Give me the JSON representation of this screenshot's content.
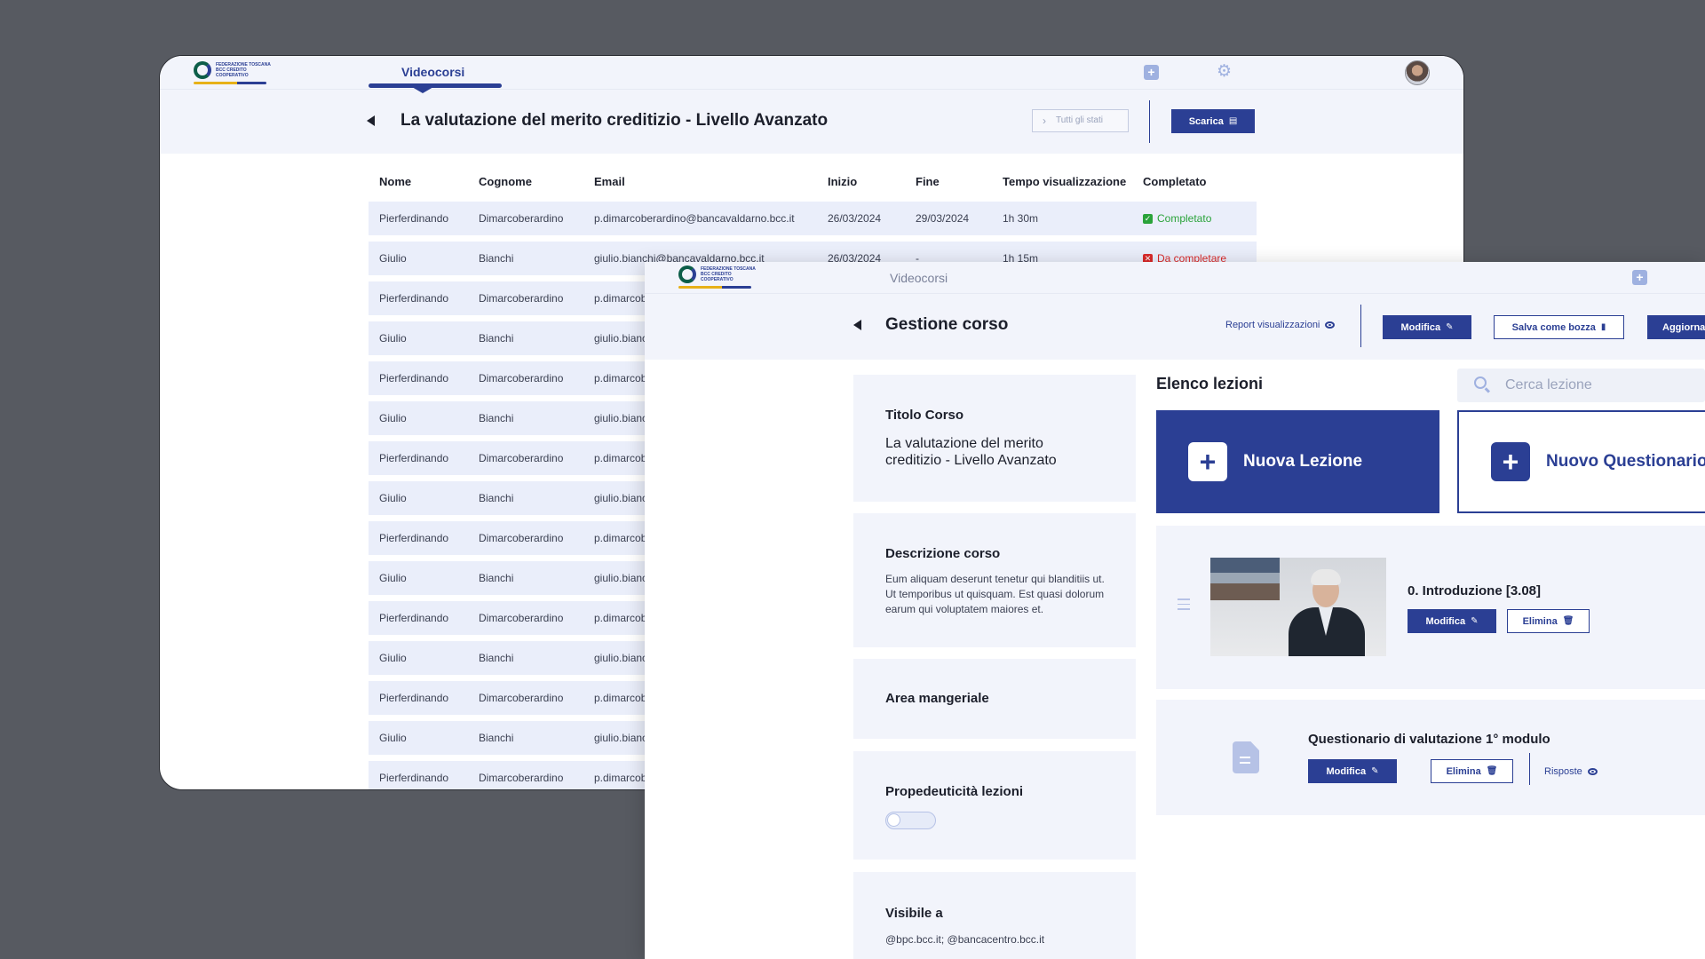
{
  "back_window": {
    "nav_tab": "Videocorsi",
    "logo_text": "FEDERAZIONE TOSCANA BCC CREDITO COOPERATIVO",
    "page_title": "La valutazione del merito creditizio - Livello Avanzato",
    "filter_placeholder": "Tutti gli stati",
    "download_label": "Scarica",
    "columns": [
      "Nome",
      "Cognome",
      "Email",
      "Inizio",
      "Fine",
      "Tempo visualizzazione",
      "Completato"
    ],
    "rows": [
      {
        "nome": "Pierferdinando",
        "cognome": "Dimarcoberardino",
        "email": "p.dimarcoberardino@bancavaldarno.bcc.it",
        "inizio": "26/03/2024",
        "fine": "29/03/2024",
        "tempo": "1h 30m",
        "stato": "Completato"
      },
      {
        "nome": "Giulio",
        "cognome": "Bianchi",
        "email": "giulio.bianchi@bancavaldarno.bcc.it",
        "inizio": "26/03/2024",
        "fine": "-",
        "tempo": "1h 15m",
        "stato": "Da completare"
      },
      {
        "nome": "Pierferdinando",
        "cognome": "Dimarcoberardino",
        "email": "p.dimarcob"
      },
      {
        "nome": "Giulio",
        "cognome": "Bianchi",
        "email": "giulio.bianc"
      },
      {
        "nome": "Pierferdinando",
        "cognome": "Dimarcoberardino",
        "email": "p.dimarcob"
      },
      {
        "nome": "Giulio",
        "cognome": "Bianchi",
        "email": "giulio.bianc"
      },
      {
        "nome": "Pierferdinando",
        "cognome": "Dimarcoberardino",
        "email": "p.dimarcob"
      },
      {
        "nome": "Giulio",
        "cognome": "Bianchi",
        "email": "giulio.bianc"
      },
      {
        "nome": "Pierferdinando",
        "cognome": "Dimarcoberardino",
        "email": "p.dimarcob"
      },
      {
        "nome": "Giulio",
        "cognome": "Bianchi",
        "email": "giulio.bianc"
      },
      {
        "nome": "Pierferdinando",
        "cognome": "Dimarcoberardino",
        "email": "p.dimarcob"
      },
      {
        "nome": "Giulio",
        "cognome": "Bianchi",
        "email": "giulio.bianc"
      },
      {
        "nome": "Pierferdinando",
        "cognome": "Dimarcoberardino",
        "email": "p.dimarcob"
      },
      {
        "nome": "Giulio",
        "cognome": "Bianchi",
        "email": "giulio.bianc"
      },
      {
        "nome": "Pierferdinando",
        "cognome": "Dimarcoberardino",
        "email": "p.dimarcob"
      }
    ]
  },
  "front_window": {
    "nav_tab": "Videocorsi",
    "page_title": "Gestione corso",
    "report_link": "Report visualizzazioni",
    "edit_label": "Modifica",
    "draft_label": "Salva come bozza",
    "update_label": "Aggiorna",
    "title_label": "Titolo Corso",
    "title_value": "La valutazione del merito creditizio - Livello Avanzato",
    "desc_label": "Descrizione corso",
    "desc_value": "Eum aliquam deserunt tenetur qui blanditiis ut. Ut temporibus ut quisquam. Est quasi dolorum earum qui voluptatem maiores et.",
    "area_label": "Area mangeriale",
    "prop_label": "Propedeuticità lezioni",
    "visible_label": "Visibile a",
    "visible_value": "@bpc.bcc.it; @bancacentro.bcc.it",
    "lessons_title": "Elenco lezioni",
    "search_placeholder": "Cerca lezione",
    "new_lesson": "Nuova Lezione",
    "new_quiz": "Nuovo Questionario",
    "lesson1_title": "0. Introduzione [3.08]",
    "lesson_edit": "Modifica",
    "lesson_delete": "Elimina",
    "quiz_title": "Questionario di valutazione 1° modulo",
    "quiz_edit": "Modifica",
    "quiz_delete": "Elimina",
    "quiz_answers": "Risposte"
  },
  "colors": {
    "primary": "#2b3f94",
    "ok": "#2aa33a",
    "ko": "#d92a2a",
    "panel": "#f2f4fb"
  },
  "icons": [
    "plus-icon",
    "gear-icon",
    "avatar",
    "download-icon",
    "edit-icon",
    "bookmark-icon",
    "eye-icon",
    "search-icon",
    "trash-icon",
    "document-icon",
    "drag-handle-icon",
    "back-arrow-icon"
  ]
}
